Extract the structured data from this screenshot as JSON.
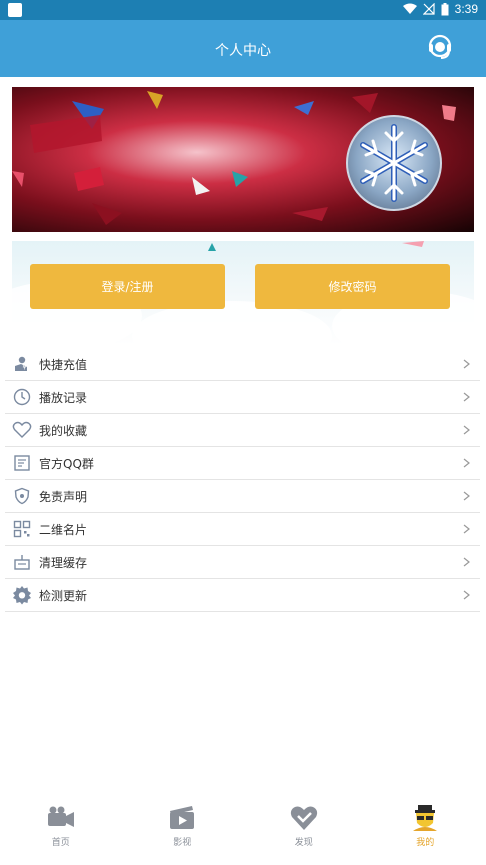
{
  "status_bar": {
    "time": "3:39"
  },
  "header": {
    "title": "个人中心",
    "support_icon": "headset-support-icon"
  },
  "login_panel": {
    "login_label": "登录/注册",
    "change_password_label": "修改密码"
  },
  "menu": {
    "items": [
      {
        "label": "快捷充值",
        "icon": "recharge-icon"
      },
      {
        "label": "播放记录",
        "icon": "clock-history-icon"
      },
      {
        "label": "我的收藏",
        "icon": "heart-icon"
      },
      {
        "label": "官方QQ群",
        "icon": "group-document-icon"
      },
      {
        "label": "免责声明",
        "icon": "shield-disclaimer-icon"
      },
      {
        "label": "二维名片",
        "icon": "qr-code-icon"
      },
      {
        "label": "清理缓存",
        "icon": "clean-cache-icon"
      },
      {
        "label": "检测更新",
        "icon": "gear-update-icon"
      }
    ]
  },
  "tabbar": {
    "tabs": [
      {
        "label": "首页",
        "icon": "camera-home-icon",
        "active": false
      },
      {
        "label": "影视",
        "icon": "film-clapper-icon",
        "active": false
      },
      {
        "label": "发现",
        "icon": "heart-discover-icon",
        "active": false
      },
      {
        "label": "我的",
        "icon": "user-mine-icon",
        "active": true
      }
    ]
  },
  "colors": {
    "header": "#3fa0d8",
    "status_bar": "#1d7fb3",
    "accent_button": "#efb83e",
    "active_tab": "#e5a52b"
  }
}
